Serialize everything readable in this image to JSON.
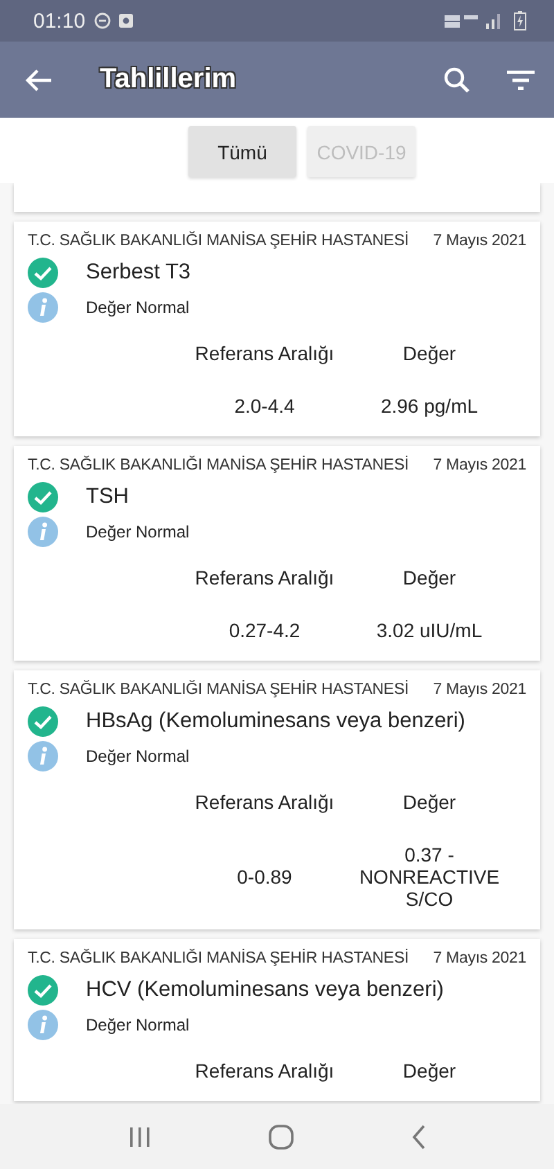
{
  "status_bar": {
    "time": "01:10"
  },
  "app_bar": {
    "title": "Tahlillerim"
  },
  "filters": [
    {
      "label": "Tümü",
      "selected": true
    },
    {
      "label": "COVID-19",
      "selected": false
    }
  ],
  "results": [
    {
      "hospital": "T.C. SAĞLIK BAKANLIĞI MANİSA ŞEHİR HASTANESİ",
      "date": "7 Mayıs 2021",
      "test": "Serbest T3",
      "normal": true,
      "status_text": "Değer Normal",
      "reference_label": "Referans Aralığı",
      "value_label": "Değer",
      "reference": "2.0-4.4",
      "value": "2.96 pg/mL"
    },
    {
      "hospital": "T.C. SAĞLIK BAKANLIĞI MANİSA ŞEHİR HASTANESİ",
      "date": "7 Mayıs 2021",
      "test": "TSH",
      "normal": true,
      "status_text": "Değer Normal",
      "reference_label": "Referans Aralığı",
      "value_label": "Değer",
      "reference": "0.27-4.2",
      "value": "3.02 uIU/mL"
    },
    {
      "hospital": "T.C. SAĞLIK BAKANLIĞI MANİSA ŞEHİR HASTANESİ",
      "date": "7 Mayıs 2021",
      "test": "HBsAg (Kemoluminesans veya benzeri)",
      "normal": true,
      "status_text": "Değer Normal",
      "reference_label": "Referans Aralığı",
      "value_label": "Değer",
      "reference": "0-0.89",
      "value": "0.37 - NONREACTIVE S/CO"
    },
    {
      "hospital": "T.C. SAĞLIK BAKANLIĞI MANİSA ŞEHİR HASTANESİ",
      "date": "7 Mayıs 2021",
      "test": "HCV (Kemoluminesans veya benzeri)",
      "normal": true,
      "status_text": "Değer Normal",
      "reference_label": "Referans Aralığı",
      "value_label": "Değer"
    }
  ]
}
